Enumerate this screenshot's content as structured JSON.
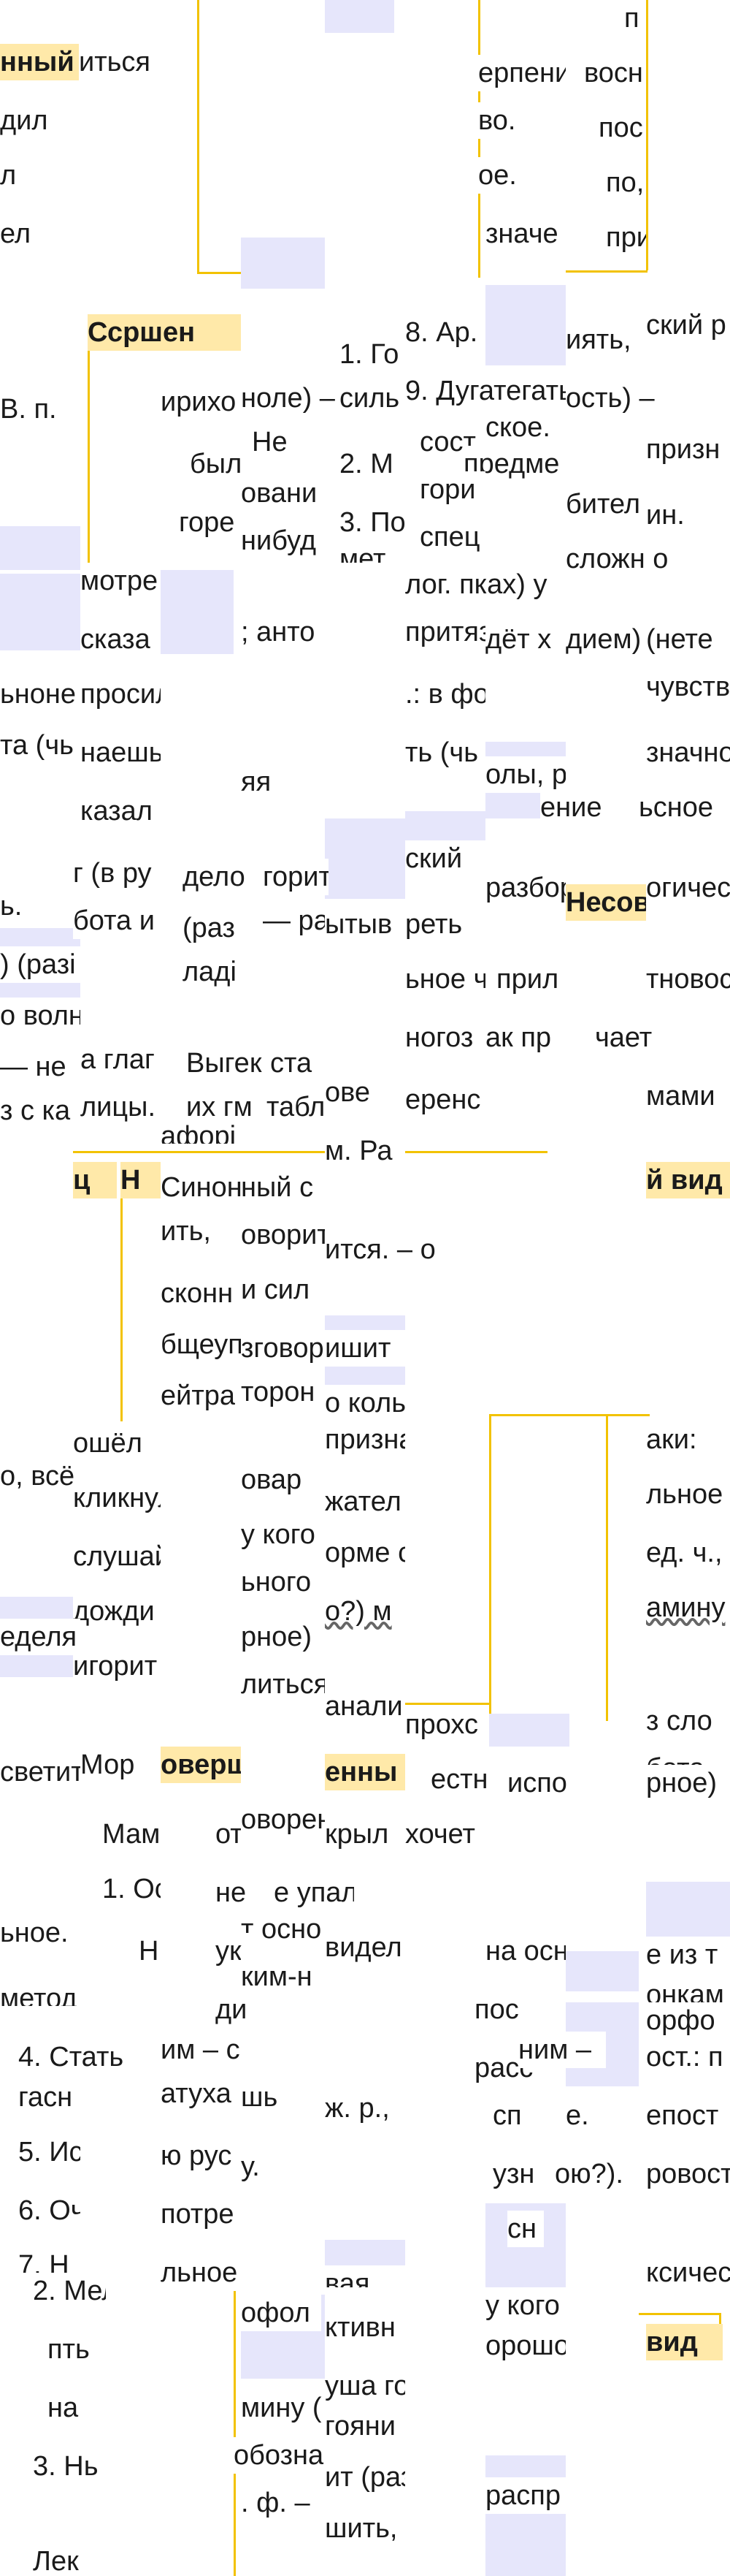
{
  "headers": {
    "h1": "нный",
    "h2": "Ссршен",
    "h3": "Несов",
    "h4": "ц",
    "h5": "Н",
    "h6": "й вид",
    "h7": "оверш",
    "h8": "енны",
    "h9": "вид"
  },
  "texts": {
    "t001": "иться",
    "t002": "дил",
    "t003": "л",
    "t004": "ел",
    "t005": "ерпени",
    "t006": "во.",
    "t007": "ое.",
    "t008": "значе",
    "t009": "п",
    "t010": "восн",
    "t011": "пос",
    "t012": "по,",
    "t013": "при",
    "t014": "8. Ар.",
    "t015": "иять,",
    "t016": "ский р",
    "t017": "1. Го",
    "t018": "силь",
    "t019": "2. М",
    "t020": "3. По",
    "t021": "мет",
    "t022": "9. Дугатегать.",
    "t023": "сост",
    "t024": "предме",
    "t025": "гори",
    "t026": "спец",
    "t027": "лог. пках) у",
    "t028": "ское.",
    "t029": "бител",
    "t030": "ость) –",
    "t031": "призн",
    "t032": "ин.",
    "t033": "сложн о",
    "t034": "В. п.",
    "t035": "ирихо",
    "t036": "ноле) –",
    "t037": "Не",
    "t038": "был",
    "t039": "овани",
    "t040": "горе",
    "t041": "нибуд",
    "t042": "мотре",
    "t043": "сказа",
    "t044": "; анто",
    "t045": "притяз",
    "t046": "дёт х",
    "t047": "дием) -",
    "t048": "(нете",
    "t049": "чувств",
    "t050": "ьноне",
    "t051": "просил",
    "t052": ".: в фо",
    "t053": "та (чь",
    "t054": "наешь",
    "t055": "ть (чь",
    "t056": "олы, р",
    "t057": "значно",
    "t058": "казал",
    "t059": "яя",
    "t060": "ение",
    "t061": "ьсное",
    "t062": "г (в ру",
    "t063": "дело",
    "t064": "горит",
    "t065": "ский",
    "t066": "разбор",
    "t067": "огичес",
    "t068": "ь.",
    "t069": "бота и",
    "t070": "(раз",
    "t071": "— раб",
    "t072": "ытыв",
    "t073": "реть",
    "t074": ") (разі",
    "t075": "ладі",
    "t076": "ьное ч",
    "t077": "прил",
    "t078": "тновост",
    "t079": "о волн",
    "t080": "ногоз",
    "t081": "ак пр",
    "t082": "чает",
    "t083": "— не",
    "t084": "а глаг",
    "t085": "Выгек",
    "t086": "ста",
    "t087": "ове",
    "t088": "еренс",
    "t089": "з с ка",
    "t090": "лицы.",
    "t091": "их гм",
    "t092": "табл",
    "t093": "мами",
    "t094": "афорі",
    "t095": "Синони",
    "t096": "ный с",
    "t097": "м. Ра",
    "t098": "ить,",
    "t099": "оворит",
    "t100": "ится. – о",
    "t101": "сконн",
    "t102": "и сил",
    "t103": "бщеуп",
    "t104": "зговор",
    "t105": "ишит",
    "t106": "ейтра",
    "t107": "торон",
    "t108": "о коль",
    "t109": "ошёл",
    "t110": "призна",
    "t111": "аки:",
    "t112": "о, всё",
    "t113": "кликнул",
    "t114": "овар",
    "t115": "жател",
    "t116": "льное",
    "t117": "слушай",
    "t118": "у кого",
    "t119": "орме с",
    "t120": "ед. ч.,",
    "t121": "дожди",
    "t122": "ьного",
    "t123": "о?) м",
    "t124": "амину",
    "t125": "еделя",
    "t126": "игорит",
    "t127": "рное)",
    "t128": "литься",
    "t129": "анали",
    "t130": "прохс",
    "t131": "з сло",
    "t132": "бота",
    "t133": "светит",
    "t134": "Мор",
    "t135": "естн",
    "t136": "испо",
    "t137": "рное)",
    "t138": "Мам",
    "t139": "от",
    "t140": "оворение.",
    "t141": "крыл",
    "t142": "хочет",
    "t143": "1. Ос",
    "t144": "не",
    "t145": "е упал",
    "t146": "т осно",
    "t147": "ьное.",
    "t148": "видел",
    "t149": "на осн",
    "t150": "е из т",
    "t151": "Н.",
    "t152": "ук",
    "t153": "ким-н",
    "t154": "онкам",
    "t155": "метод",
    "t156": "ди",
    "t157": "пос",
    "t158": "орфо",
    "t159": "4. Стать",
    "t160": "им – с",
    "t161": "расс",
    "t162": "ним –",
    "t163": "ост.: п",
    "t164": "гасн",
    "t165": "атуха",
    "t166": "шь",
    "t167": "ж. р.,",
    "t168": "сп",
    "t169": "е.",
    "t170": "епост",
    "t171": "5. Ис",
    "t172": "ю рус",
    "t173": "у.",
    "t174": "узн",
    "t175": "ою?).",
    "t176": "ровост",
    "t177": "6. Оч",
    "t178": "потре",
    "t179": "сн",
    "t180": "7. Н",
    "t181": "льное",
    "t182": "вая",
    "t183": "ксическ",
    "t184": "2. Мел",
    "t185": "ктивн",
    "t186": "у кого",
    "t187": "пть",
    "t188": "офол",
    "t189": "орошо",
    "t190": "на",
    "t191": "мину (",
    "t192": "уша го",
    "t193": "гояни",
    "t194": "3. Нь",
    "t195": "обозна",
    "t196": "ит (раз",
    "t197": "распр",
    "t198": ". ф. –",
    "t199": "шить,",
    "t200": "Лек"
  }
}
